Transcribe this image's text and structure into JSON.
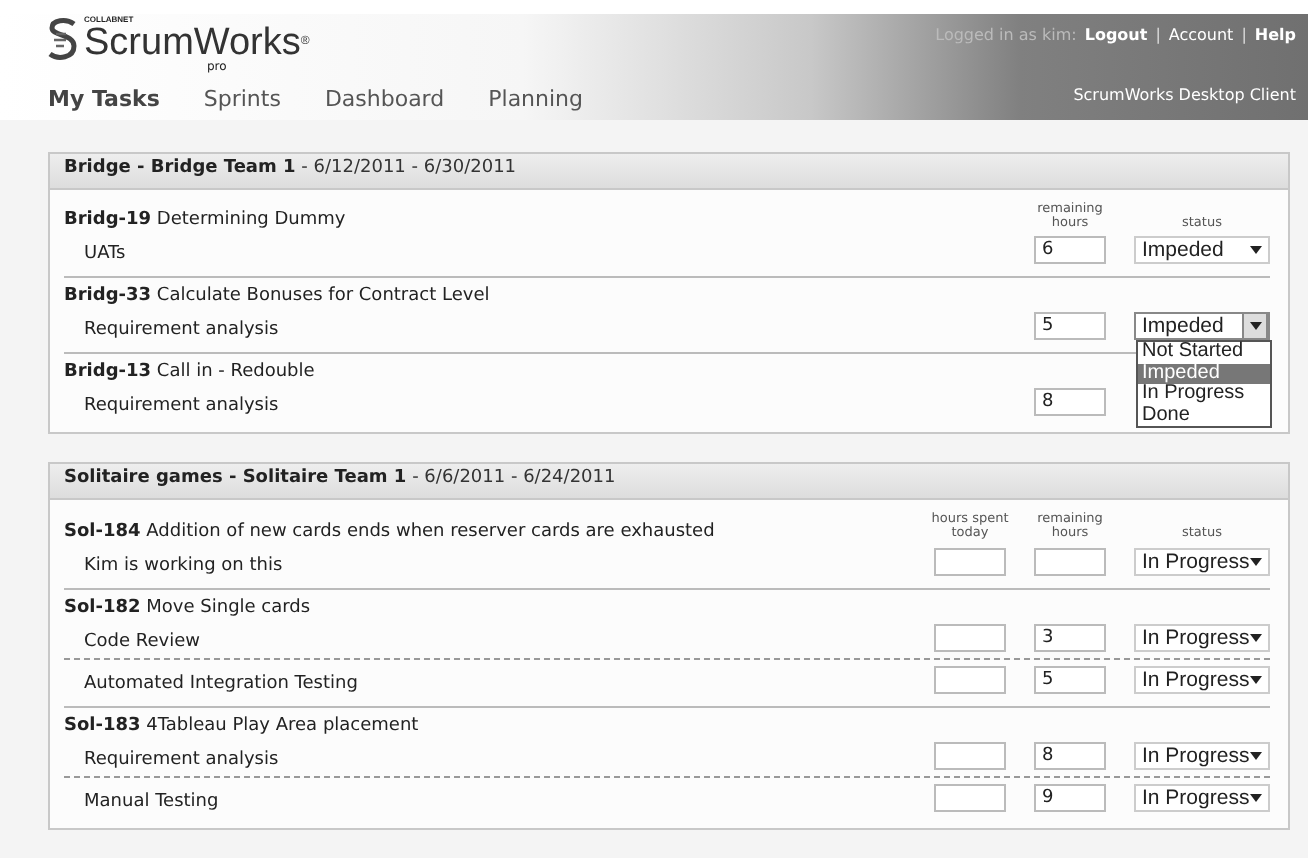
{
  "header": {
    "logo": {
      "vendor": "COLLABNET",
      "name": "ScrumWorks",
      "mark": "®",
      "edition": "pro"
    },
    "user": {
      "logged_in": "Logged in as kim:",
      "separator": "|",
      "links": [
        {
          "label": "Logout",
          "bold": true
        },
        {
          "label": "Account",
          "bold": false
        },
        {
          "label": "Help",
          "bold": true
        }
      ]
    },
    "tabs": [
      {
        "label": "My Tasks",
        "selected": true
      },
      {
        "label": "Sprints",
        "selected": false
      },
      {
        "label": "Dashboard",
        "selected": false
      },
      {
        "label": "Planning",
        "selected": false
      }
    ],
    "client_link": "ScrumWorks Desktop Client"
  },
  "sprints": [
    {
      "name": "Bridge - Bridge Team 1",
      "dates": "- 6/12/2011 - 6/30/2011",
      "columns": [
        {
          "kind": "remaining",
          "label": "remaining hours"
        },
        {
          "kind": "status",
          "label": "status"
        }
      ],
      "stories": [
        {
          "id": "Bridg-19",
          "title": "Determining Dummy",
          "tasks": [
            {
              "name": "UATs",
              "remaining": "6",
              "status": "Impeded"
            }
          ]
        },
        {
          "id": "Bridg-33",
          "title": "Calculate Bonuses for Contract Level",
          "tasks": [
            {
              "name": "Requirement analysis",
              "remaining": "5",
              "status": "Impeded",
              "expanded": true,
              "options": [
                {
                  "label": "Not Started",
                  "selected": false
                },
                {
                  "label": "Impeded",
                  "selected": true
                },
                {
                  "label": "In Progress",
                  "selected": false
                },
                {
                  "label": "Done",
                  "selected": false
                }
              ]
            }
          ]
        },
        {
          "id": "Bridg-13",
          "title": "Call in - Redouble",
          "tasks": [
            {
              "name": "Requirement analysis",
              "remaining": "8"
            }
          ]
        }
      ]
    },
    {
      "name": "Solitaire games - Solitaire Team 1",
      "dates": "- 6/6/2011 - 6/24/2011",
      "columns": [
        {
          "kind": "spent",
          "label": "hours spent today"
        },
        {
          "kind": "remaining",
          "label": "remaining hours"
        },
        {
          "kind": "status",
          "label": "status"
        }
      ],
      "stories": [
        {
          "id": "Sol-184",
          "title": "Addition of new cards ends when reserver cards are exhausted",
          "tasks": [
            {
              "name": "Kim is working on this",
              "status": "In Progress"
            }
          ]
        },
        {
          "id": "Sol-182",
          "title": "Move Single cards",
          "tasks": [
            {
              "name": "Code Review",
              "remaining": "3",
              "status": "In Progress"
            },
            {
              "name": "Automated Integration Testing",
              "remaining": "5",
              "status": "In Progress"
            }
          ]
        },
        {
          "id": "Sol-183",
          "title": "4Tableau Play Area placement",
          "tasks": [
            {
              "name": "Requirement analysis",
              "remaining": "8",
              "status": "In Progress"
            },
            {
              "name": "Manual Testing",
              "remaining": "9",
              "status": "In Progress"
            }
          ]
        }
      ]
    }
  ]
}
